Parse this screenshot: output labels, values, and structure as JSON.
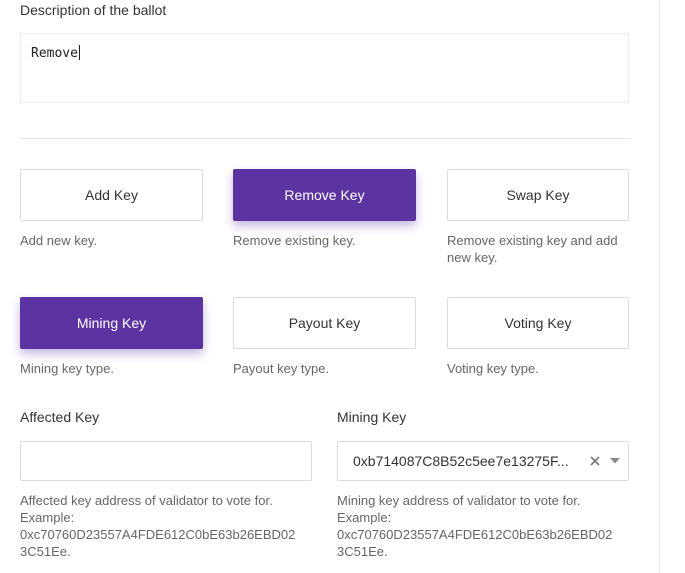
{
  "description": {
    "label": "Description of the ballot",
    "value": "Remove"
  },
  "ballot_types": [
    {
      "label": "Add Key",
      "hint": "Add new key.",
      "active": false
    },
    {
      "label": "Remove Key",
      "hint": "Remove existing key.",
      "active": true
    },
    {
      "label": "Swap Key",
      "hint_line1": "Remove existing key and add",
      "hint_line2": "new key.",
      "active": false
    }
  ],
  "key_types": [
    {
      "label": "Mining Key",
      "hint": "Mining key type.",
      "active": true
    },
    {
      "label": "Payout Key",
      "hint": "Payout key type.",
      "active": false
    },
    {
      "label": "Voting Key",
      "hint": "Voting key type.",
      "active": false
    }
  ],
  "affected_key": {
    "label": "Affected Key",
    "value": "",
    "hint_line1": "Affected key address of validator to vote for.",
    "hint_line2": "Example:",
    "hint_line3": "0xc70760D23557A4FDE612C0bE63b26EBD02",
    "hint_line4": "3C51Ee."
  },
  "mining_key": {
    "label": "Mining Key",
    "value": "0xb714087C8B52c5ee7e13275F...",
    "hint_line1": "Mining key address of validator to vote for.",
    "hint_line2": "Example:",
    "hint_line3": "0xc70760D23557A4FDE612C0bE63b26EBD02",
    "hint_line4": "3C51Ee."
  },
  "colors": {
    "accent": "#5c34a2",
    "border": "#dcdcdc",
    "hint_text": "#666666"
  },
  "icons": {
    "clear": "close-icon",
    "dropdown": "chevron-down-icon"
  }
}
